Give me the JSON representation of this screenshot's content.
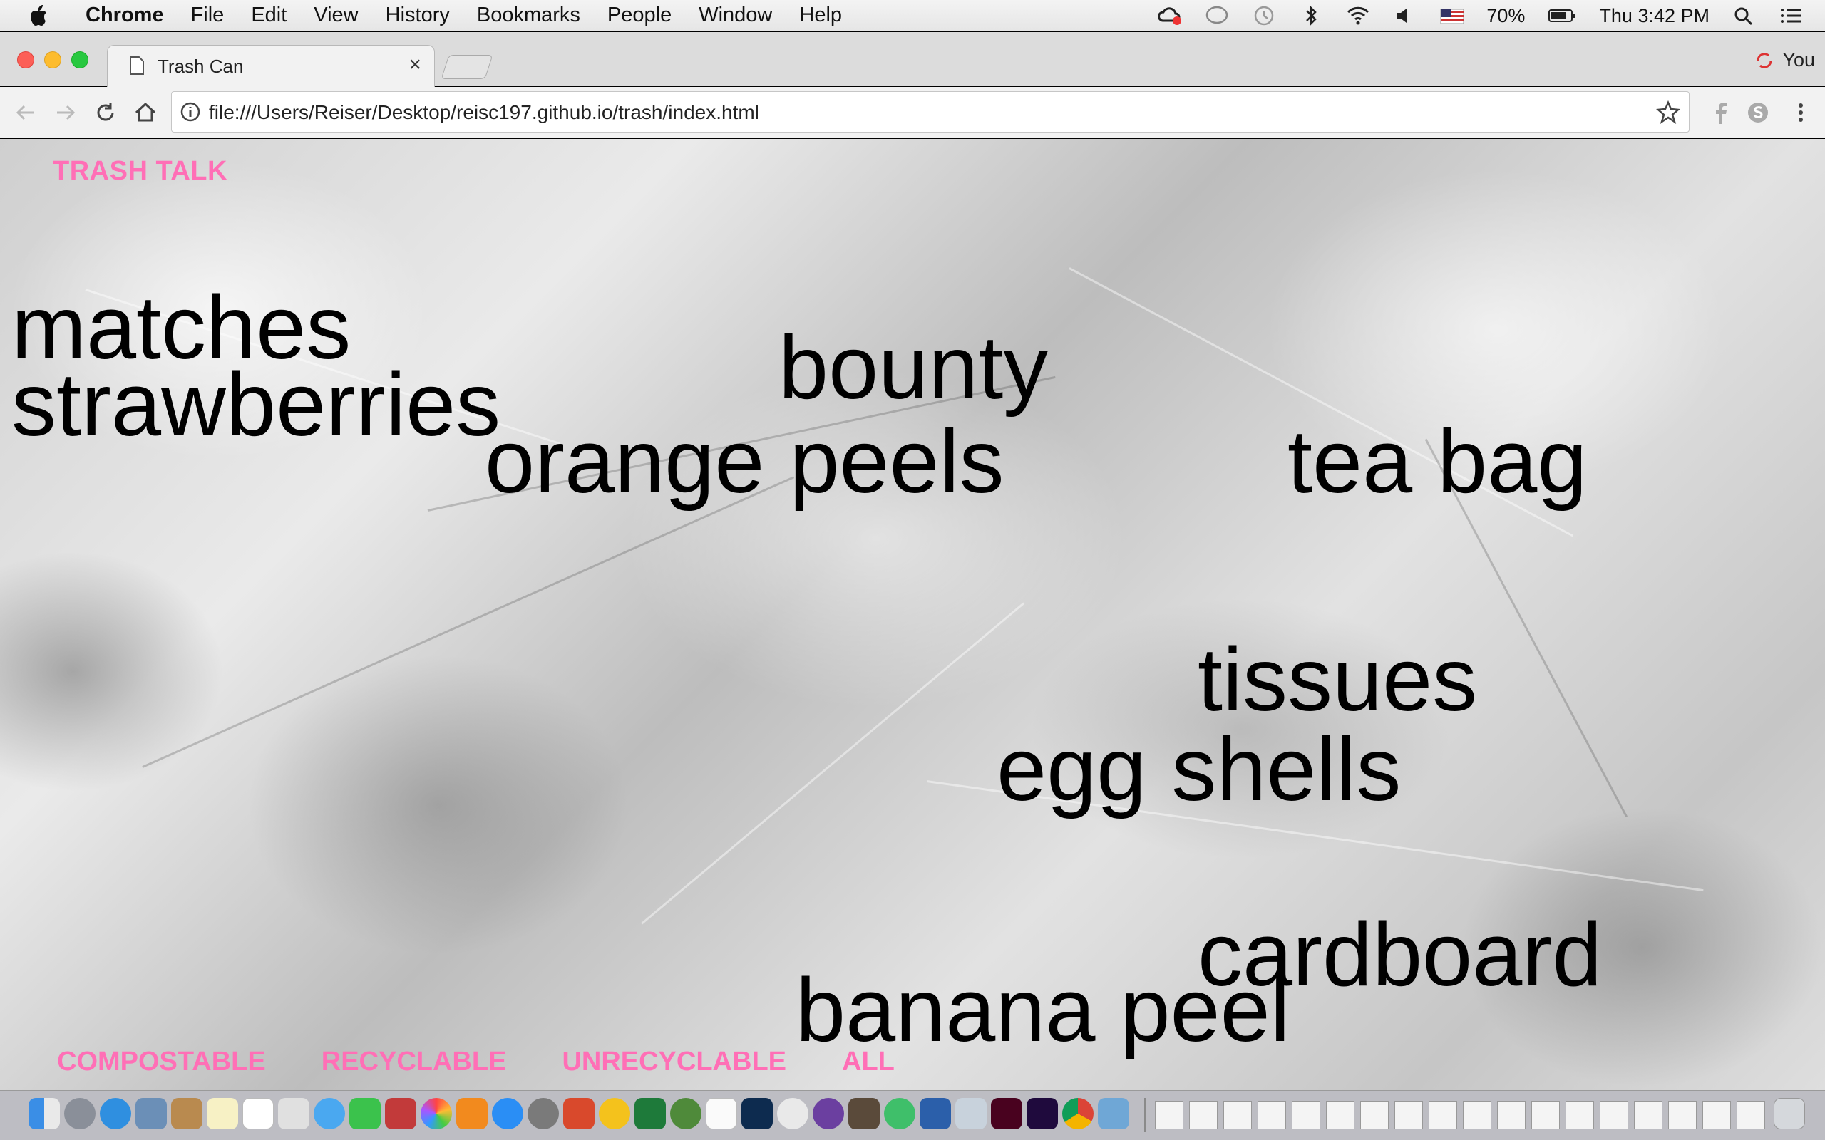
{
  "menubar": {
    "app": "Chrome",
    "items": [
      "File",
      "Edit",
      "View",
      "History",
      "Bookmarks",
      "People",
      "Window",
      "Help"
    ],
    "battery": "70%",
    "clock": "Thu 3:42 PM"
  },
  "browser": {
    "tab_title": "Trash Can",
    "tab_close": "×",
    "profile_label": "You",
    "url": "file:///Users/Reiser/Desktop/reisc197.github.io/trash/index.html"
  },
  "page": {
    "site_title": "TRASH TALK",
    "words": [
      "matches",
      "strawberries",
      "bounty",
      "orange peels",
      "tea bag",
      "tissues",
      "egg shells",
      "cardboard",
      "banana peel"
    ],
    "filters": [
      "COMPOSTABLE",
      "RECYCLABLE",
      "UNRECYCLABLE",
      "ALL"
    ]
  },
  "colors": {
    "accent_pink": "#ff6fb6",
    "word_text": "#000000"
  }
}
